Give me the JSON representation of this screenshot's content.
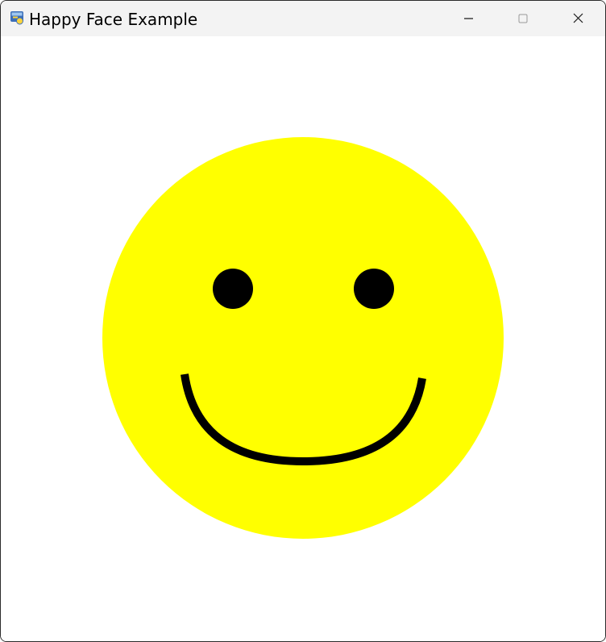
{
  "window": {
    "title": "Happy Face Example",
    "icon": "python-icon",
    "controls": [
      "minimize-icon",
      "maximize-icon",
      "close-icon"
    ]
  },
  "face": {
    "face_color": "#ffff00",
    "feature_color": "#000000",
    "background_color": "#ffffff"
  }
}
